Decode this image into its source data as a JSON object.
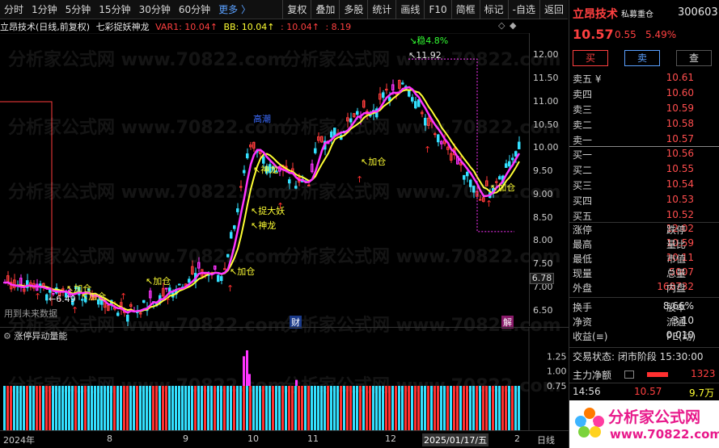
{
  "toolbar": {
    "periods": [
      "分时",
      "1分钟",
      "5分钟",
      "15分钟",
      "30分钟",
      "60分钟"
    ],
    "more": "更多 〉",
    "tools": [
      "复权",
      "叠加",
      "多股",
      "统计",
      "画线",
      "F10",
      "简框",
      "标记",
      "-自选",
      "返回"
    ]
  },
  "chart_header": {
    "title": "立昂技术(日线,前复权)",
    "indicator": "七彩捉妖神龙",
    "var1": "VAR1: 10.04↑",
    "bb": "BB: 10.04↑",
    "val3": ": 10.04↑",
    "val4": ": 8.19"
  },
  "watermark": "分析家公式网 www.70822.com",
  "main_chart": {
    "y_ticks": [
      "12.00",
      "11.50",
      "11.00",
      "10.50",
      "10.00",
      "9.50",
      "9.00",
      "8.50",
      "8.00",
      "7.50",
      "7.00",
      "6.50"
    ],
    "ylim": [
      6.3,
      12.2
    ],
    "price_label": "6.78",
    "max_label": "11.92",
    "min_label": "6.49",
    "future_note": "用到未来数据",
    "labels": {
      "jiacang": "加仓",
      "shenlong": "神龙",
      "zhuodayao": "捉大妖",
      "wenshang": "稳4.8%",
      "xuanfeng": "高潮",
      "cai": "财",
      "jie": "解"
    }
  },
  "sub_chart": {
    "title": "涨停异动量能",
    "y_ticks": [
      "1.25",
      "1.00",
      "0.75"
    ]
  },
  "x_axis": [
    "2024年",
    "8",
    "9",
    "10",
    "11",
    "12",
    "2025/01/17/五",
    "2",
    "日线"
  ],
  "right_panel": {
    "stock_name": "立昂技术",
    "tag": "私募重仓",
    "code": "300603",
    "price": "10.57",
    "change": "0.55",
    "pct": "5.49%",
    "buy_btn": "买",
    "sell_btn": "卖",
    "check_btn": "查",
    "asks": [
      {
        "label": "卖五 ¥",
        "price": "10.61"
      },
      {
        "label": "卖四",
        "price": "10.60"
      },
      {
        "label": "卖三",
        "price": "10.59"
      },
      {
        "label": "卖二",
        "price": "10.58"
      },
      {
        "label": "卖一",
        "price": "10.57"
      }
    ],
    "bids": [
      {
        "label": "买一",
        "price": "10.56"
      },
      {
        "label": "买二",
        "price": "10.55"
      },
      {
        "label": "买三",
        "price": "10.54"
      },
      {
        "label": "买四",
        "price": "10.53"
      },
      {
        "label": "买五",
        "price": "10.52"
      }
    ],
    "stats": [
      {
        "l1": "涨停",
        "v1": "12.02",
        "l2": "跌停"
      },
      {
        "l1": "最高",
        "v1": "10.59",
        "l2": "量比"
      },
      {
        "l1": "最低",
        "v1": "10.11",
        "l2": "市值"
      },
      {
        "l1": "现量",
        "v1": "5007",
        "l2": "总量"
      },
      {
        "l1": "外盘",
        "v1": "168732",
        "l2": "内盘"
      }
    ],
    "stats2": [
      {
        "l1": "换手",
        "v1": "8.66%",
        "l2": "股本"
      },
      {
        "l1": "净资",
        "v1": "3.10",
        "l2": "流通"
      },
      {
        "l1": "收益(≡)",
        "v1": "0.010",
        "l2": "PE(动)"
      }
    ],
    "trade_status": "交易状态: 闭市阶段 15:30:00",
    "main_flow_label": "主力净额",
    "main_flow_value": "1323",
    "tick_time": "14:56",
    "tick_price": "10.57",
    "tick_vol": "9.7万",
    "logo_text": "分析家公式网",
    "logo_url": "www.70822.com"
  }
}
